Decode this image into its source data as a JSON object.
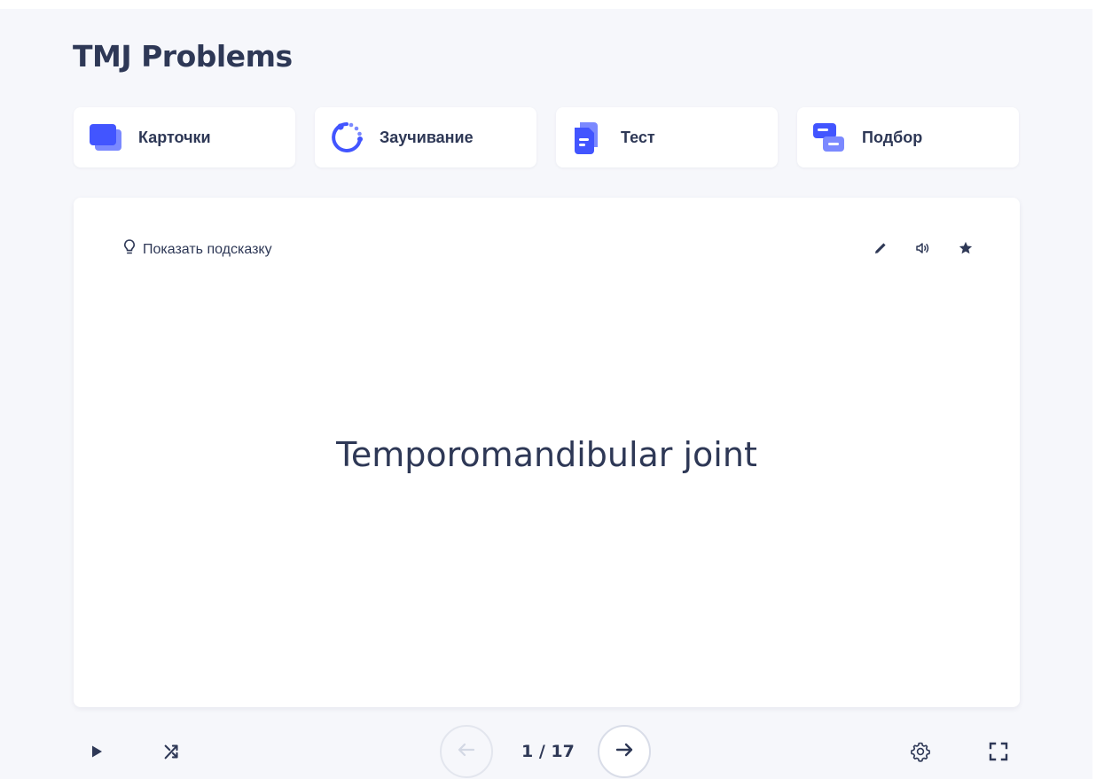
{
  "set": {
    "title": "TMJ Problems"
  },
  "modes": [
    {
      "label": "Карточки",
      "icon": "flashcards-icon"
    },
    {
      "label": "Заучивание",
      "icon": "learn-icon"
    },
    {
      "label": "Тест",
      "icon": "test-icon"
    },
    {
      "label": "Подбор",
      "icon": "match-icon"
    }
  ],
  "card": {
    "hint_label": "Показать подсказку",
    "term": "Temporomandibular joint",
    "tools": [
      "edit-icon",
      "audio-icon",
      "star-icon"
    ]
  },
  "controls": {
    "counter": "1 / 17",
    "current": 1,
    "total": 17
  },
  "colors": {
    "background": "#f6f7fb",
    "text": "#2e3856",
    "accent": "#4255ff",
    "accent_light": "#7b89ff",
    "icon_gray": "#586380",
    "disabled": "#d9dde8"
  }
}
